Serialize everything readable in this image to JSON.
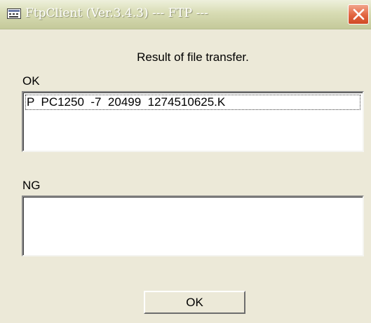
{
  "window": {
    "title": "FtpClient (Ver.3.4.3) --- FTP ---",
    "icon": "network-window-icon",
    "close_icon": "close-x-icon"
  },
  "result_label": "Result of file transfer.",
  "ok_section": {
    "label": "OK",
    "items": [
      "P  PC1250  -7  20499  1274510625.K"
    ]
  },
  "ng_section": {
    "label": "NG",
    "items": []
  },
  "button": {
    "ok_label": "OK"
  },
  "colors": {
    "titlebar": "#d8dcb4",
    "close_button": "#e2643f",
    "dialog_background": "#ece9d8"
  }
}
